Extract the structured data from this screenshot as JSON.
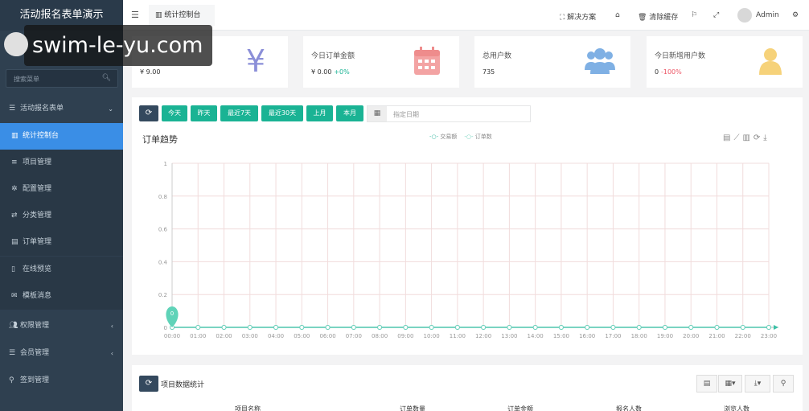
{
  "app_title": "活动报名表单演示",
  "user_name": "Admin",
  "watermark": "swim-le-yu.com",
  "search_placeholder": "搜索菜单",
  "menu": [
    {
      "label": "活动报名表单",
      "icon": "list-icon",
      "expanded": true
    },
    {
      "label": "统计控制台",
      "icon": "bar-chart-icon",
      "active": true
    },
    {
      "label": "项目管理",
      "icon": "list-icon"
    },
    {
      "label": "配置管理",
      "icon": "gear-icon"
    },
    {
      "label": "分类管理",
      "icon": "random-icon"
    },
    {
      "label": "订单管理",
      "icon": "file-icon"
    },
    {
      "label": "在线预览",
      "icon": "mobile-icon"
    },
    {
      "label": "模板消息",
      "icon": "envelope-icon"
    },
    {
      "label": "权限管理",
      "icon": "users-icon"
    },
    {
      "label": "会员管理",
      "icon": "list-icon"
    },
    {
      "label": "签到管理",
      "icon": "map-marker-icon"
    }
  ],
  "topbar": {
    "tab_label": "统计控制台",
    "solutions_label": "解决方案",
    "clear_cache_label": "清除缓存",
    "admin_label": "Admin"
  },
  "cards": [
    {
      "title": "",
      "value": "¥ 9.00",
      "change": "",
      "icon": "yen-icon",
      "color": "#8b8fd8"
    },
    {
      "title": "今日订单金额",
      "value": "¥ 0.00",
      "change": "+0%",
      "change_color": "#1ab394",
      "icon": "calendar-icon",
      "color": "#f08a8a"
    },
    {
      "title": "总用户数",
      "value": "735",
      "change": "",
      "icon": "users-icon",
      "color": "#5b9bd5"
    },
    {
      "title": "今日新增用户数",
      "value": "0",
      "change": "-100%",
      "change_color": "#ed5565",
      "icon": "user-icon",
      "color": "#f3c95a"
    }
  ],
  "filters": [
    "今天",
    "昨天",
    "最近7天",
    "最近30天",
    "上月",
    "本月"
  ],
  "date_placeholder": "指定日期",
  "chart_title": "订单趋势",
  "legend": [
    "交易额",
    "订单数"
  ],
  "bottom_title": "项目数据统计",
  "table_headers": [
    "项目名称",
    "订单数量",
    "订单金额",
    "报名人数",
    "浏览人数"
  ],
  "chart_data": {
    "type": "line",
    "x": [
      "00:00",
      "01:00",
      "02:00",
      "03:00",
      "04:00",
      "05:00",
      "06:00",
      "07:00",
      "08:00",
      "09:00",
      "10:00",
      "11:00",
      "12:00",
      "13:00",
      "14:00",
      "15:00",
      "16:00",
      "17:00",
      "18:00",
      "19:00",
      "20:00",
      "21:00",
      "22:00",
      "23:00"
    ],
    "series": [
      {
        "name": "交易额",
        "values": [
          0,
          0,
          0,
          0,
          0,
          0,
          0,
          0,
          0,
          0,
          0,
          0,
          0,
          0,
          0,
          0,
          0,
          0,
          0,
          0,
          0,
          0,
          0,
          0
        ]
      },
      {
        "name": "订单数",
        "values": [
          0,
          0,
          0,
          0,
          0,
          0,
          0,
          0,
          0,
          0,
          0,
          0,
          0,
          0,
          0,
          0,
          0,
          0,
          0,
          0,
          0,
          0,
          0,
          0
        ]
      }
    ],
    "ylim": [
      0,
      1
    ],
    "yticks": [
      "0",
      "0.2",
      "0.4",
      "0.6",
      "0.8",
      "1"
    ],
    "marker_label": "0",
    "grid": true,
    "legend_position": "top-center"
  }
}
